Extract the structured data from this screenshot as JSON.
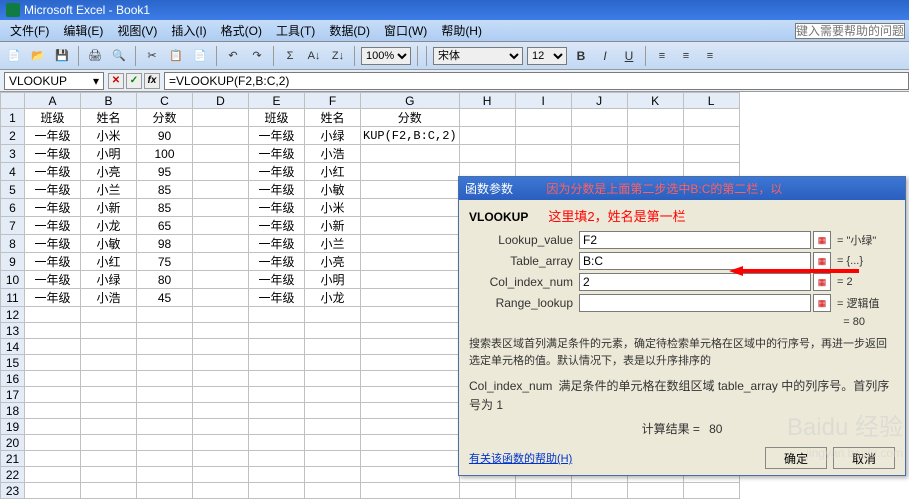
{
  "window_title": "Microsoft Excel - Book1",
  "menus": [
    "文件(F)",
    "编辑(E)",
    "视图(V)",
    "插入(I)",
    "格式(O)",
    "工具(T)",
    "数据(D)",
    "窗口(W)",
    "帮助(H)"
  ],
  "help_placeholder": "键入需要帮助的问题",
  "zoom": "100%",
  "font_name": "宋体",
  "font_size": "12",
  "name_box": "VLOOKUP",
  "formula": "=VLOOKUP(F2,B:C,2)",
  "columns": [
    "A",
    "B",
    "C",
    "D",
    "E",
    "F",
    "G",
    "H",
    "I",
    "J",
    "K",
    "L"
  ],
  "rows": [
    "1",
    "2",
    "3",
    "4",
    "5",
    "6",
    "7",
    "8",
    "9",
    "10",
    "11",
    "12",
    "13",
    "14",
    "15",
    "16",
    "17",
    "18",
    "19",
    "20",
    "21",
    "22",
    "23"
  ],
  "data": {
    "A1": "班级",
    "B1": "姓名",
    "C1": "分数",
    "E1": "班级",
    "F1": "姓名",
    "G1": "分数",
    "A2": "一年级",
    "B2": "小米",
    "C2": "90",
    "E2": "一年级",
    "F2": "小绿",
    "G2": "KUP(F2,B:C,2)",
    "A3": "一年级",
    "B3": "小明",
    "C3": "100",
    "E3": "一年级",
    "F3": "小浩",
    "A4": "一年级",
    "B4": "小亮",
    "C4": "95",
    "E4": "一年级",
    "F4": "小红",
    "A5": "一年级",
    "B5": "小兰",
    "C5": "85",
    "E5": "一年级",
    "F5": "小敏",
    "A6": "一年级",
    "B6": "小新",
    "C6": "85",
    "E6": "一年级",
    "F6": "小米",
    "A7": "一年级",
    "B7": "小龙",
    "C7": "65",
    "E7": "一年级",
    "F7": "小新",
    "A8": "一年级",
    "B8": "小敏",
    "C8": "98",
    "E8": "一年级",
    "F8": "小兰",
    "A9": "一年级",
    "B9": "小红",
    "C9": "75",
    "E9": "一年级",
    "F9": "小亮",
    "A10": "一年级",
    "B10": "小绿",
    "C10": "80",
    "E10": "一年级",
    "F10": "小明",
    "A11": "一年级",
    "B11": "小浩",
    "C11": "45",
    "E11": "一年级",
    "F11": "小龙"
  },
  "dialog": {
    "title": "函数参数",
    "annotation_line1": "因为分数是上面第二步选中B:C的第二栏，以",
    "annotation_line2": "这里填2，姓名是第一栏",
    "func": "VLOOKUP",
    "args": {
      "lookup_value": {
        "label": "Lookup_value",
        "value": "F2",
        "result": "= \"小绿\""
      },
      "table_array": {
        "label": "Table_array",
        "value": "B:C",
        "result": "= {...}"
      },
      "col_index": {
        "label": "Col_index_num",
        "value": "2",
        "result": "= 2"
      },
      "range_lookup": {
        "label": "Range_lookup",
        "value": "",
        "result": "= 逻辑值"
      }
    },
    "overall_result": "= 80",
    "desc1": "搜索表区域首列满足条件的元素，确定待检索单元格在区域中的行序号，再进一步返回选定单元格的值。默认情况下，表是以升序排序的",
    "desc2_label": "Col_index_num",
    "desc2_text": "满足条件的单元格在数组区域 table_array 中的列序号。首列序号为 1",
    "calc_label": "计算结果 =",
    "calc_value": "80",
    "help_link": "有关该函数的帮助(H)",
    "ok": "确定",
    "cancel": "取消"
  },
  "watermark1": "Baidu 经验",
  "watermark2": "jingyan.baidu.com"
}
